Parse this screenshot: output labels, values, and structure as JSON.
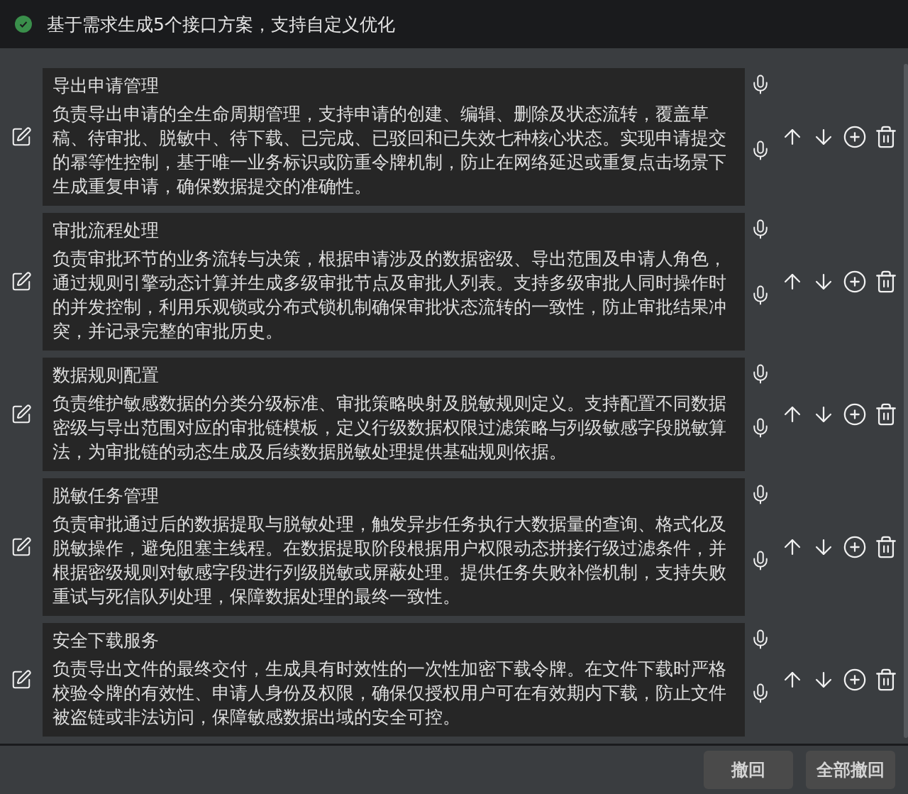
{
  "header": {
    "message": "基于需求生成5个接口方案，支持自定义优化"
  },
  "items": [
    {
      "title": "导出申请管理",
      "description": "负责导出申请的全生命周期管理，支持申请的创建、编辑、删除及状态流转，覆盖草稿、待审批、脱敏中、待下载、已完成、已驳回和已失效七种核心状态。实现申请提交的幂等性控制，基于唯一业务标识或防重令牌机制，防止在网络延迟或重复点击场景下生成重复申请，确保数据提交的准确性。"
    },
    {
      "title": "审批流程处理",
      "description": "负责审批环节的业务流转与决策，根据申请涉及的数据密级、导出范围及申请人角色，通过规则引擎动态计算并生成多级审批节点及审批人列表。支持多级审批人同时操作时的并发控制，利用乐观锁或分布式锁机制确保审批状态流转的一致性，防止审批结果冲突，并记录完整的审批历史。"
    },
    {
      "title": "数据规则配置",
      "description": "负责维护敏感数据的分类分级标准、审批策略映射及脱敏规则定义。支持配置不同数据密级与导出范围对应的审批链模板，定义行级数据权限过滤策略与列级敏感字段脱敏算法，为审批链的动态生成及后续数据脱敏处理提供基础规则依据。"
    },
    {
      "title": "脱敏任务管理",
      "description": "负责审批通过后的数据提取与脱敏处理，触发异步任务执行大数据量的查询、格式化及脱敏操作，避免阻塞主线程。在数据提取阶段根据用户权限动态拼接行级过滤条件，并根据密级规则对敏感字段进行列级脱敏或屏蔽处理。提供任务失败补偿机制，支持失败重试与死信队列处理，保障数据处理的最终一致性。"
    },
    {
      "title": "安全下载服务",
      "description": "负责导出文件的最终交付，生成具有时效性的一次性加密下载令牌。在文件下载时严格校验令牌的有效性、申请人身份及权限，确保仅授权用户可在有效期内下载，防止文件被盗链或非法访问，保障敏感数据出域的安全可控。"
    }
  ],
  "buttons": [
    "撤回",
    "全部撤回"
  ]
}
